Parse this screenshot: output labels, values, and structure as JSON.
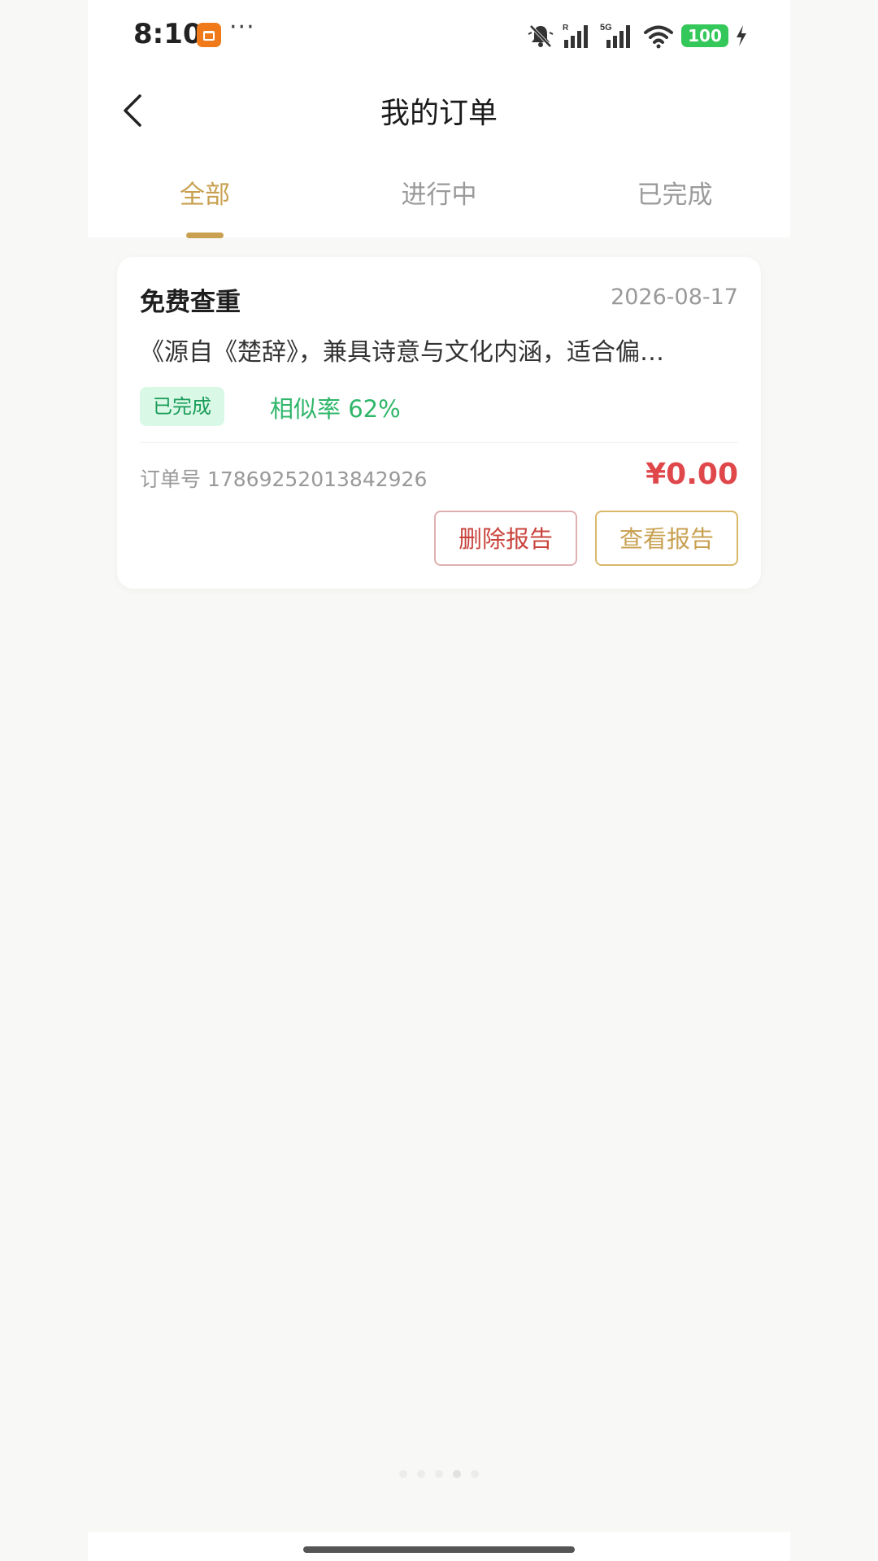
{
  "status_bar": {
    "time": "8:10",
    "more": "···",
    "battery": "100",
    "network_label": "5G",
    "roaming_label": "R"
  },
  "header": {
    "title": "我的订单"
  },
  "tabs": [
    {
      "label": "全部",
      "active": true
    },
    {
      "label": "进行中",
      "active": false
    },
    {
      "label": "已完成",
      "active": false
    }
  ],
  "order": {
    "title": "免费查重",
    "date": "2026-08-17",
    "description": "《源自《楚辞》，兼具诗意与文化内涵，适合偏…",
    "status": "已完成",
    "similarity": "相似率 62%",
    "order_no": "订单号 17869252013842926",
    "price": "¥0.00",
    "delete_label": "删除报告",
    "view_label": "查看报告"
  },
  "colors": {
    "accent": "#c8a050",
    "price": "#e0474b",
    "success": "#2fb66a",
    "battery": "#34c759"
  }
}
